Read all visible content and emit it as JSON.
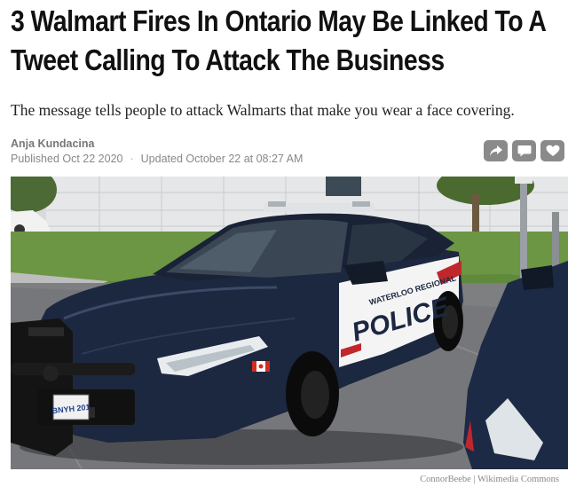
{
  "article": {
    "headline": "3 Walmart Fires In Ontario May Be Linked To A Tweet Calling To Attack The Business",
    "dek": "The message tells people to attack Walmarts that make you wear a face covering.",
    "author": "Anja Kundacina",
    "published": "Published Oct 22 2020",
    "separator": "·",
    "updated": "Updated October 22 at 08:27 AM"
  },
  "share": {
    "icons": [
      "share-icon",
      "comment-icon",
      "heart-icon"
    ],
    "color": "#8a8a8a"
  },
  "photo": {
    "car_text_top": "WATERLOO REGIONAL",
    "car_text_main": "POLICE",
    "plate": "BNYH 201",
    "credit": "ConnorBeebe | Wikimedia Commons"
  }
}
